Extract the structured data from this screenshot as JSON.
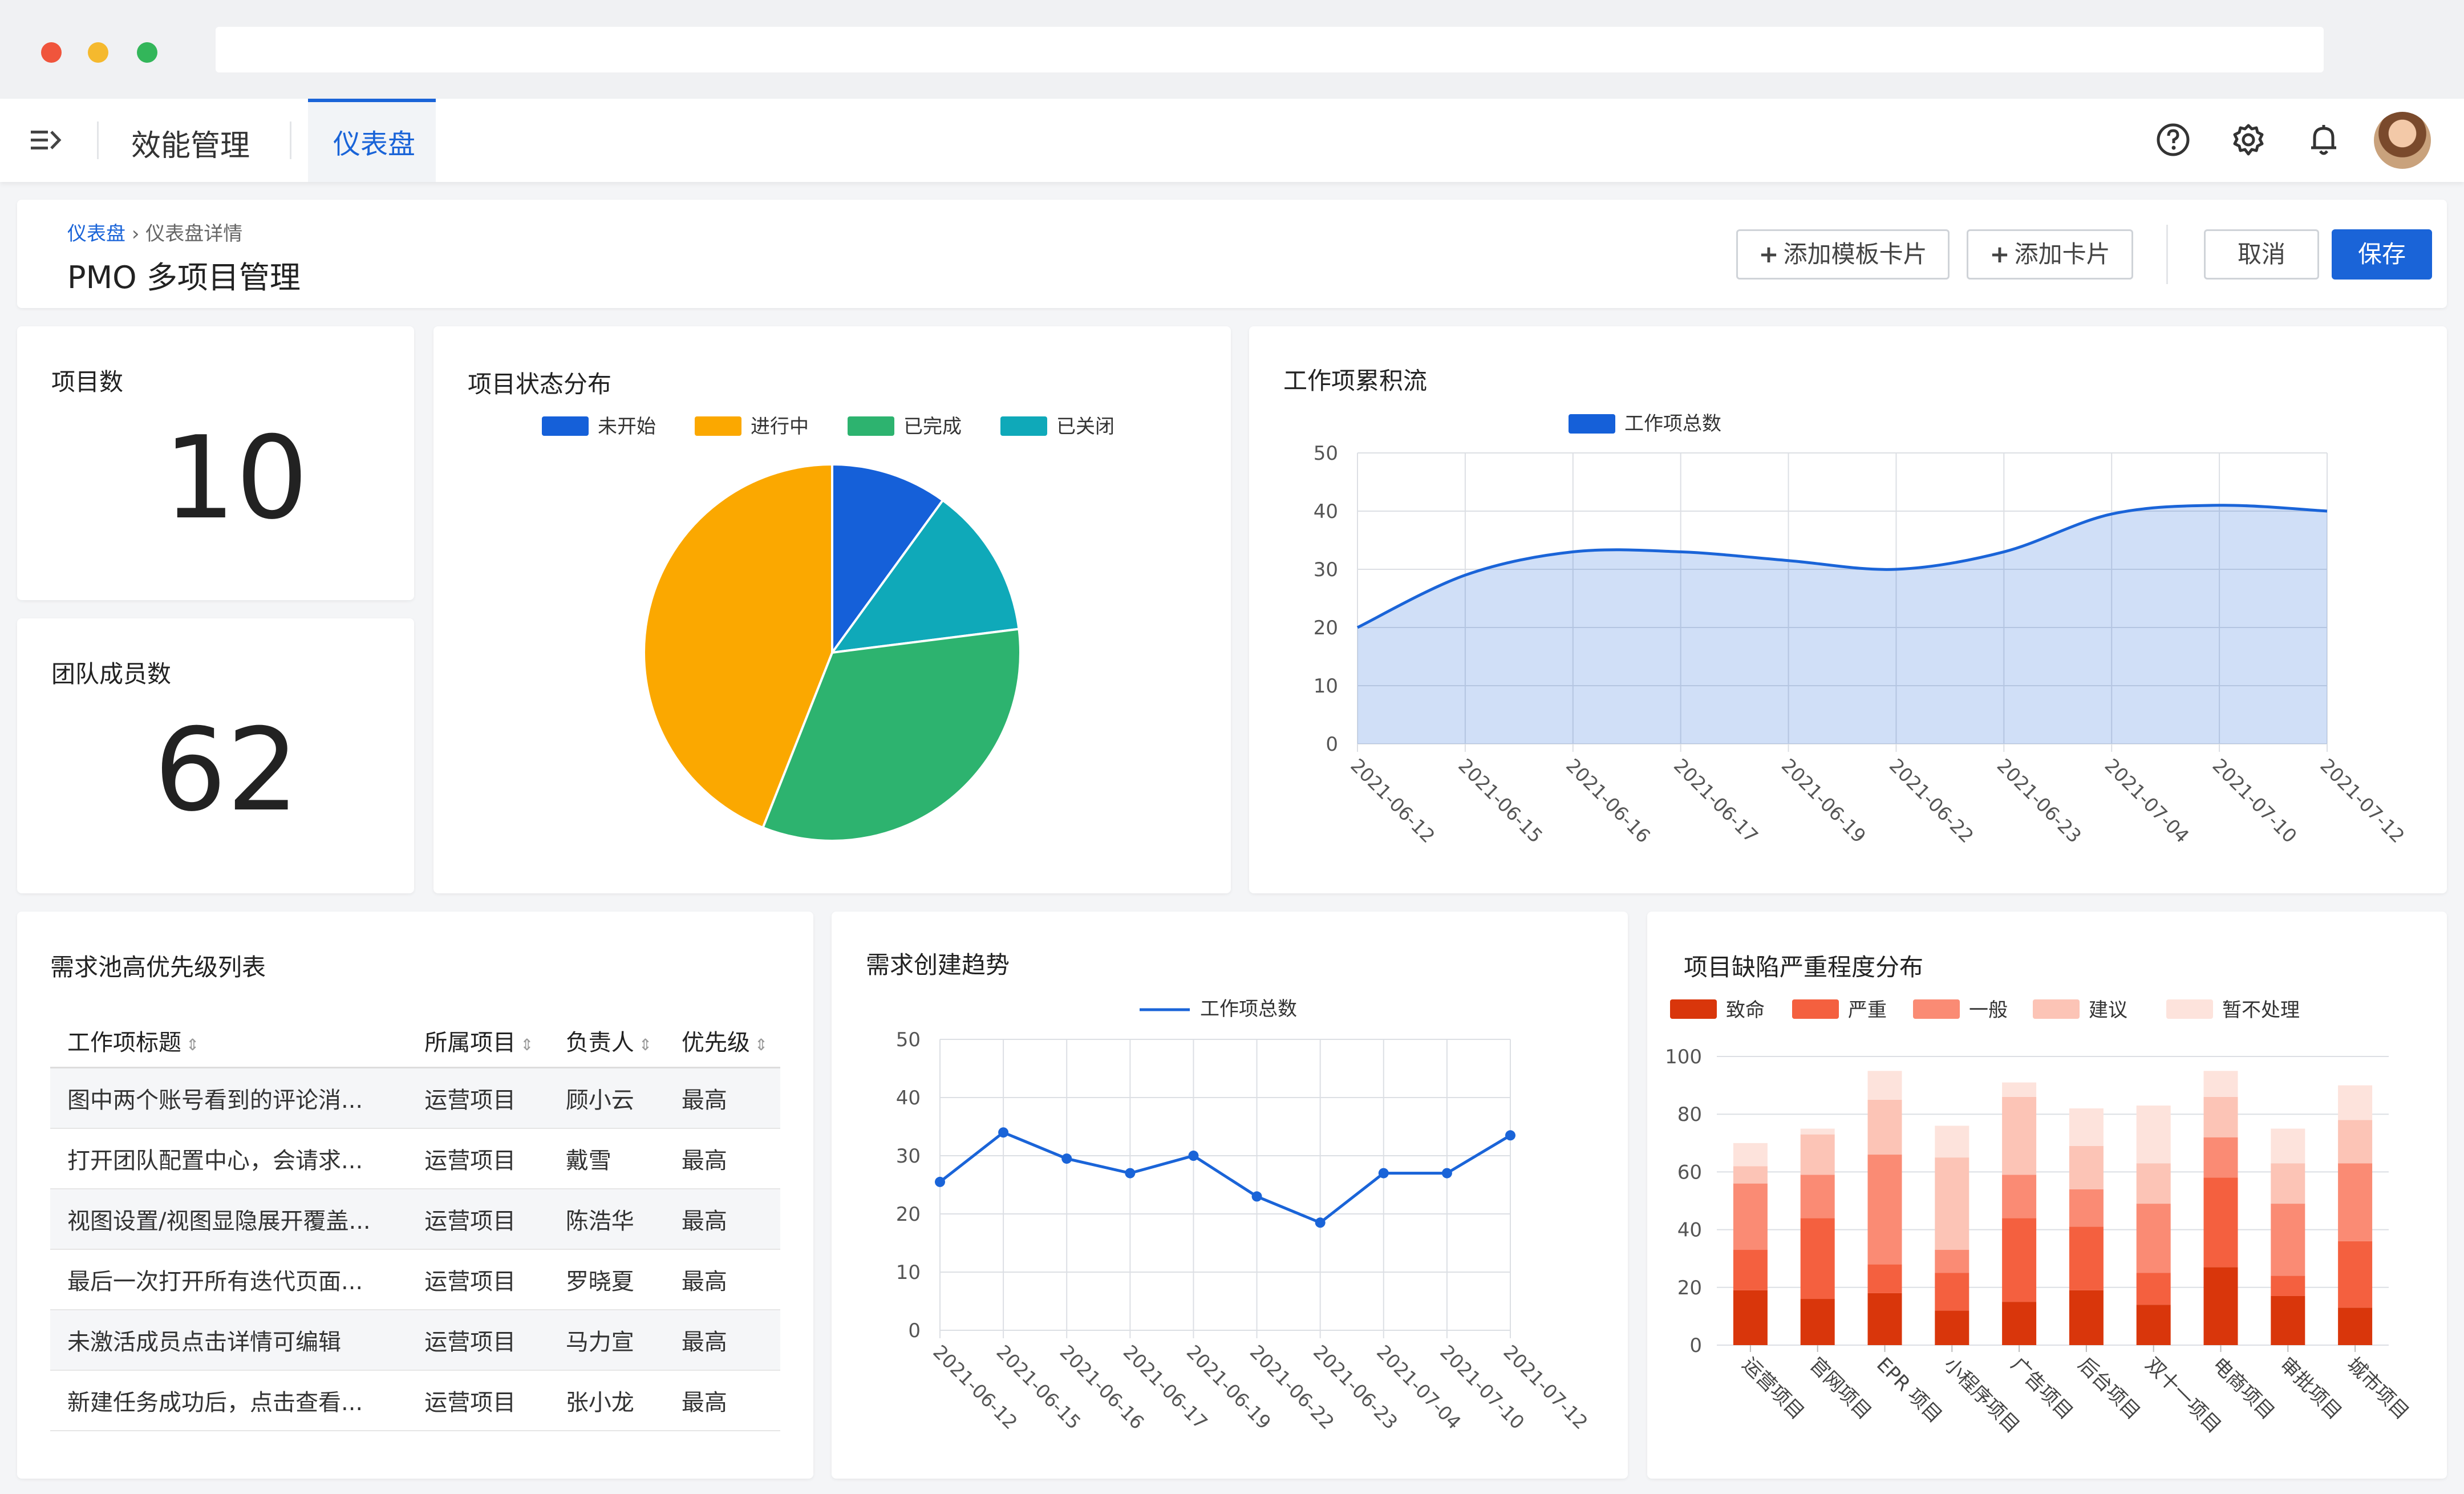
{
  "nav": {
    "module_title": "效能管理",
    "active_tab": "仪表盘",
    "icons": [
      "help-icon",
      "gear-icon",
      "bell-icon"
    ]
  },
  "header": {
    "breadcrumb_root": "仪表盘",
    "breadcrumb_sep": "›",
    "breadcrumb_current": "仪表盘详情",
    "title": "PMO 多项目管理",
    "btn_add_template": "添加模板卡片",
    "btn_add_card": "添加卡片",
    "btn_cancel": "取消",
    "btn_save": "保存"
  },
  "stats": {
    "projects_label": "项目数",
    "projects_value": "10",
    "members_label": "团队成员数",
    "members_value": "62"
  },
  "requirement_table": {
    "title": "需求池高优先级列表",
    "columns": [
      "工作项标题",
      "所属项目",
      "负责人",
      "优先级"
    ],
    "rows": [
      [
        "图中两个账号看到的评论消...",
        "运营项目",
        "顾小云",
        "最高"
      ],
      [
        "打开团队配置中心，会请求...",
        "运营项目",
        "戴雪",
        "最高"
      ],
      [
        "视图设置/视图显隐展开覆盖...",
        "运营项目",
        "陈浩华",
        "最高"
      ],
      [
        "最后一次打开所有迭代页面...",
        "运营项目",
        "罗晓夏",
        "最高"
      ],
      [
        "未激活成员点击详情可编辑",
        "运营项目",
        "马力宣",
        "最高"
      ],
      [
        "新建任务成功后，点击查看...",
        "运营项目",
        "张小龙",
        "最高"
      ]
    ]
  },
  "colors": {
    "primary": "#1a64d8",
    "not_started": "#1560d9",
    "in_progress": "#fba800",
    "completed": "#2db36f",
    "closed": "#0fa9b9",
    "defect": [
      "#d9360b",
      "#f4603f",
      "#fa8b74",
      "#fcc4b6",
      "#fde3dc"
    ]
  },
  "chart_data": [
    {
      "type": "pie",
      "title": "项目状态分布",
      "legend": "top",
      "slices": [
        {
          "name": "未开始",
          "value": 1,
          "color": "#1560d9"
        },
        {
          "name": "已关闭",
          "value": 1.3,
          "color": "#0fa9b9"
        },
        {
          "name": "已完成",
          "value": 3.3,
          "color": "#2db36f"
        },
        {
          "name": "进行中",
          "value": 4.4,
          "color": "#fba800"
        }
      ],
      "legend_order": [
        "未开始",
        "进行中",
        "已完成",
        "已关闭"
      ]
    },
    {
      "type": "area",
      "title": "工作项累积流",
      "legend": "top",
      "categories": [
        "2021-06-12",
        "2021-06-15",
        "2021-06-16",
        "2021-06-17",
        "2021-06-19",
        "2021-06-22",
        "2021-06-23",
        "2021-07-04",
        "2021-07-10",
        "2021-07-12"
      ],
      "series": [
        {
          "name": "工作项总数",
          "values": [
            20,
            29,
            33,
            33,
            31.5,
            30,
            33,
            39.5,
            41,
            40
          ]
        }
      ],
      "ylim": [
        0,
        50
      ],
      "yticks": [
        0,
        10,
        20,
        30,
        40,
        50
      ],
      "grid": true
    },
    {
      "type": "line",
      "title": "需求创建趋势",
      "legend": "top",
      "categories": [
        "2021-06-12",
        "2021-06-15",
        "2021-06-16",
        "2021-06-17",
        "2021-06-19",
        "2021-06-22",
        "2021-06-23",
        "2021-07-04",
        "2021-07-10",
        "2021-07-12"
      ],
      "series": [
        {
          "name": "工作项总数",
          "values": [
            25.5,
            34,
            29.5,
            27,
            30,
            23,
            18.5,
            27,
            27,
            33.5
          ]
        }
      ],
      "ylim": [
        0,
        50
      ],
      "yticks": [
        0,
        10,
        20,
        30,
        40,
        50
      ],
      "grid": true
    },
    {
      "type": "bar",
      "stacked": true,
      "title": "项目缺陷严重程度分布",
      "legend": "top",
      "categories": [
        "运营项目",
        "官网项目",
        "EPR 项目",
        "小程序项目",
        "广告项目",
        "后台项目",
        "双十一项目",
        "电商项目",
        "审批项目",
        "城市项目"
      ],
      "series": [
        {
          "name": "致命",
          "values": [
            19,
            16,
            18,
            12,
            15,
            19,
            14,
            27,
            17,
            13
          ]
        },
        {
          "name": "严重",
          "values": [
            14,
            28,
            10,
            13,
            29,
            22,
            11,
            31,
            7,
            23
          ]
        },
        {
          "name": "一般",
          "values": [
            23,
            15,
            38,
            8,
            15,
            13,
            24,
            14,
            25,
            27
          ]
        },
        {
          "name": "建议",
          "values": [
            6,
            14,
            19,
            32,
            27,
            15,
            14,
            14,
            14,
            15
          ]
        },
        {
          "name": "暂不处理",
          "values": [
            8,
            2,
            10,
            11,
            5,
            13,
            20,
            9,
            12,
            12
          ]
        }
      ],
      "ylim": [
        0,
        100
      ],
      "yticks": [
        0,
        20,
        40,
        60,
        80,
        100
      ],
      "grid": true
    }
  ]
}
